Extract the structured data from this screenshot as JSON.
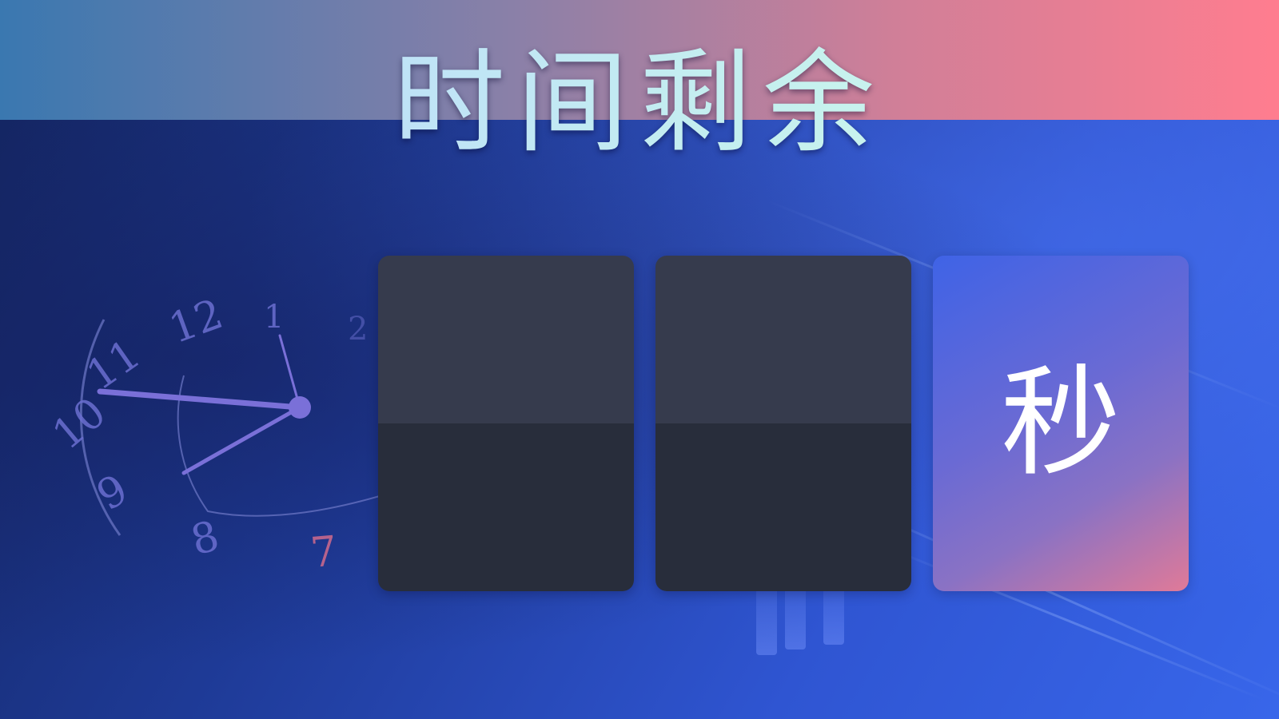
{
  "title": "时间剩余",
  "countdown": {
    "digits": [
      "",
      ""
    ],
    "unit_label": "秒"
  },
  "background": {
    "clock_numerals": [
      "12",
      "11",
      "10",
      "9",
      "8",
      "7",
      "1",
      "2"
    ]
  },
  "colors": {
    "top_band_start": "#3a78b0",
    "top_band_end": "#ff7d8f",
    "background_dark": "#13245e",
    "background_light": "#3866ea",
    "card_top": "#363b4d",
    "card_bottom": "#282d3b",
    "title_text": "#c5f0ef",
    "unit_card_accent": "#e07a98"
  }
}
